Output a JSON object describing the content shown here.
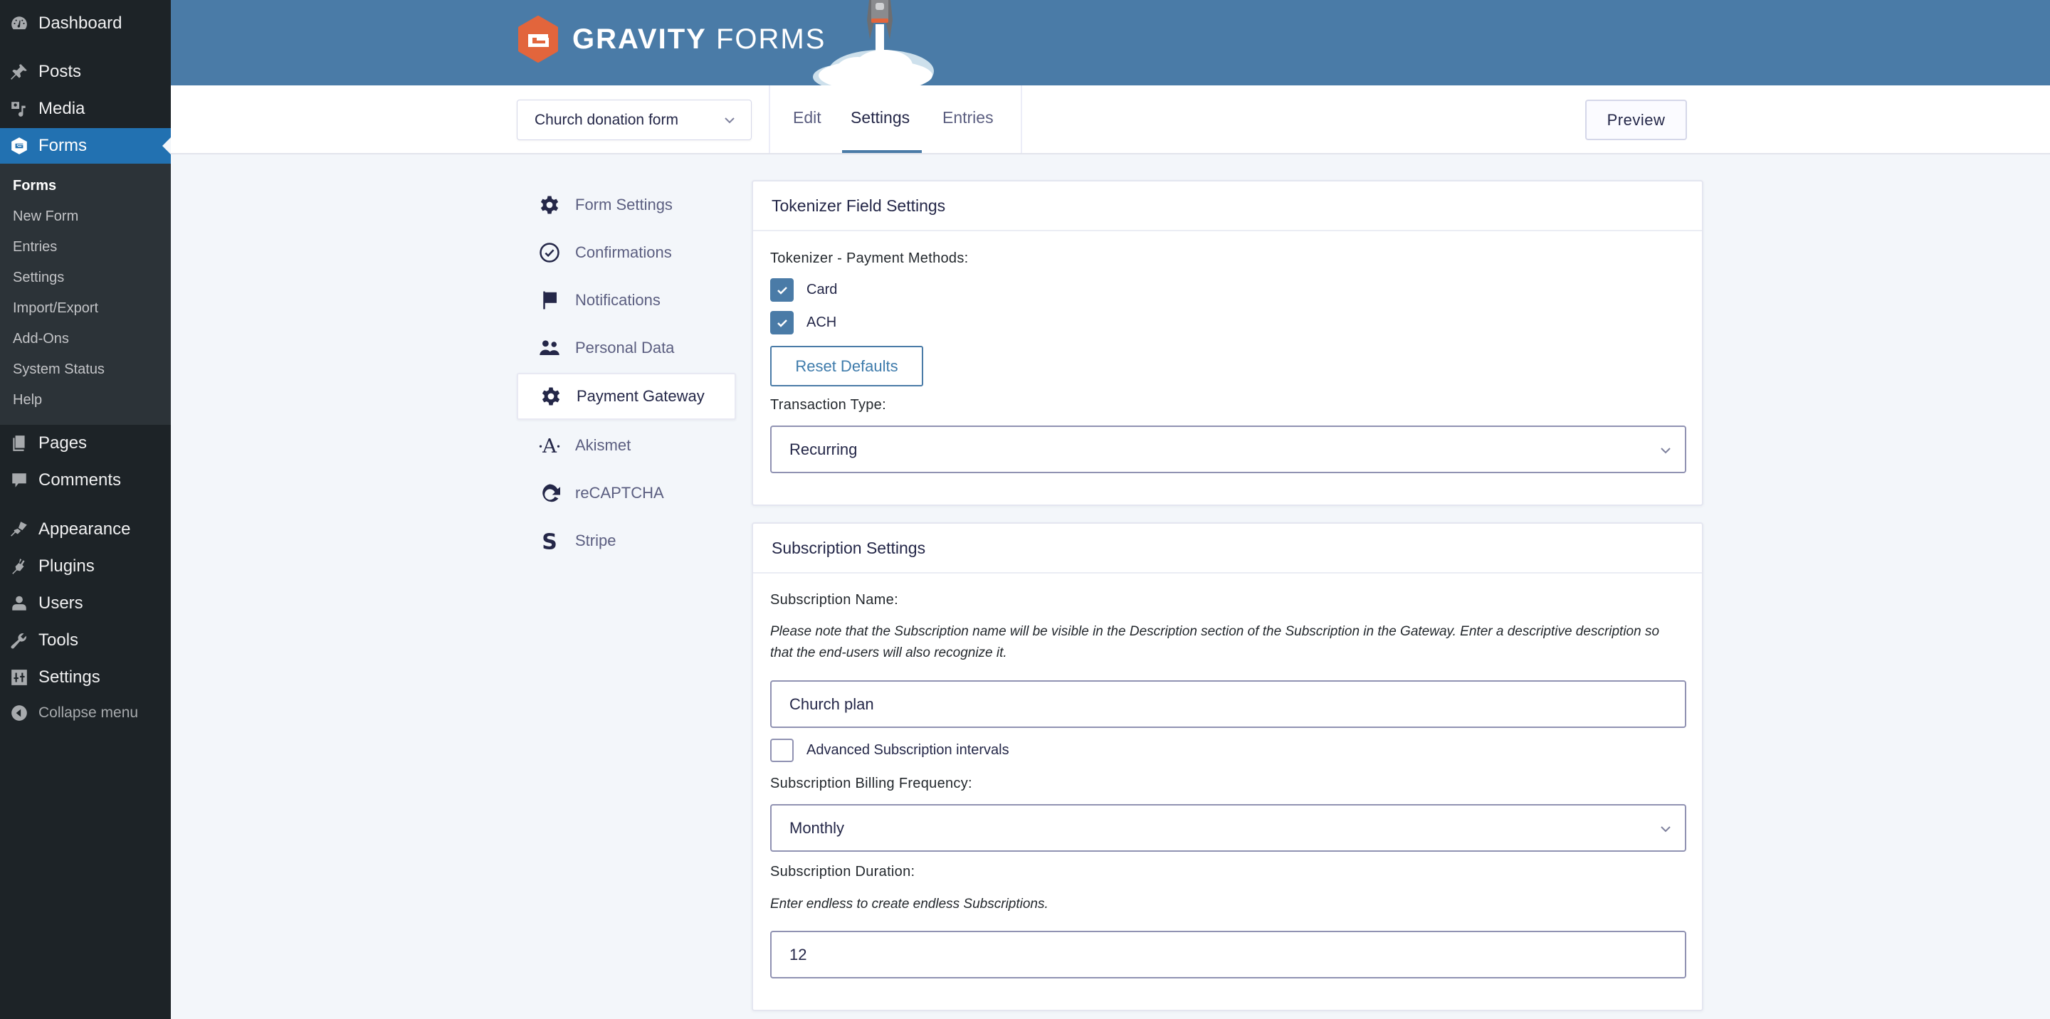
{
  "wp_menu": {
    "items": [
      {
        "label": "Dashboard",
        "icon": "dashboard-icon"
      },
      {
        "label": "Posts",
        "icon": "pin-icon"
      },
      {
        "label": "Media",
        "icon": "media-icon"
      },
      {
        "label": "Forms",
        "icon": "gravity-forms-icon",
        "active": true
      },
      {
        "label": "Pages",
        "icon": "pages-icon"
      },
      {
        "label": "Comments",
        "icon": "comment-icon"
      },
      {
        "label": "Appearance",
        "icon": "paintbrush-icon"
      },
      {
        "label": "Plugins",
        "icon": "plugin-icon"
      },
      {
        "label": "Users",
        "icon": "user-icon"
      },
      {
        "label": "Tools",
        "icon": "wrench-icon"
      },
      {
        "label": "Settings",
        "icon": "settings-sliders-icon"
      }
    ],
    "submenu": [
      "Forms",
      "New Form",
      "Entries",
      "Settings",
      "Import/Export",
      "Add-Ons",
      "System Status",
      "Help"
    ],
    "collapse_label": "Collapse menu"
  },
  "header": {
    "brand_bold": "GRAVITY",
    "brand_light": "FORMS",
    "brand_color": "#e2653c",
    "header_bg": "#4a7ba7"
  },
  "nav": {
    "form_selector": "Church donation form",
    "tabs": [
      {
        "label": "Edit"
      },
      {
        "label": "Settings",
        "active": true
      },
      {
        "label": "Entries"
      }
    ],
    "preview_label": "Preview"
  },
  "settings_nav": {
    "items": [
      {
        "label": "Form Settings",
        "icon": "gear-icon"
      },
      {
        "label": "Confirmations",
        "icon": "check-circle-icon"
      },
      {
        "label": "Notifications",
        "icon": "flag-icon"
      },
      {
        "label": "Personal Data",
        "icon": "people-icon"
      },
      {
        "label": "Payment Gateway",
        "icon": "gear-icon",
        "active": true
      },
      {
        "label": "Akismet",
        "icon": "akismet-icon"
      },
      {
        "label": "reCAPTCHA",
        "icon": "recaptcha-icon"
      },
      {
        "label": "Stripe",
        "icon": "stripe-icon"
      }
    ]
  },
  "tokenizer_panel": {
    "title": "Tokenizer Field Settings",
    "payment_methods_label": "Tokenizer - Payment Methods:",
    "methods": [
      {
        "label": "Card",
        "checked": true
      },
      {
        "label": "ACH",
        "checked": true
      }
    ],
    "reset_label": "Reset Defaults",
    "transaction_type_label": "Transaction Type:",
    "transaction_type_value": "Recurring"
  },
  "subscription_panel": {
    "title": "Subscription Settings",
    "name_label": "Subscription Name:",
    "name_desc": "Please note that the Subscription name will be visible in the Description section of the Subscription in the Gateway. Enter a descriptive description so that the end-users will also recognize it.",
    "name_value": "Church plan",
    "advanced_label": "Advanced Subscription intervals",
    "advanced_checked": false,
    "frequency_label": "Subscription Billing Frequency:",
    "frequency_value": "Monthly",
    "duration_label": "Subscription Duration:",
    "duration_desc": "Enter endless to create endless Subscriptions.",
    "duration_value": "12"
  }
}
